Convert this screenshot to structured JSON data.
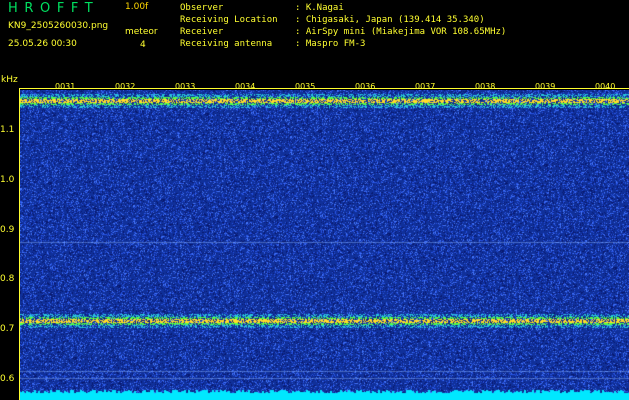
{
  "header": {
    "app_title": "HROFFT",
    "version": "1.00f",
    "file_name": "KN9_2505260030.png",
    "mode_label": "meteor",
    "timestamp": "25.05.26 00:30",
    "mode_count": "4"
  },
  "info": {
    "rows": [
      {
        "label": "Observer",
        "value": ": K.Nagai"
      },
      {
        "label": "Receiving Location",
        "value": ": Chigasaki, Japan (139.414 35.340)"
      },
      {
        "label": "Receiver",
        "value": ": AirSpy mini (Miakejima VOR 108.65MHz)"
      },
      {
        "label": "Receiving antenna",
        "value": ": Maspro FM-3"
      }
    ]
  },
  "axis": {
    "y_unit": "kHz",
    "y_ticks": [
      "1.1",
      "1.0",
      "0.9",
      "0.8",
      "0.7",
      "0.6"
    ],
    "x_ticks": [
      "0031",
      "0032",
      "0033",
      "0034",
      "0035",
      "0036",
      "0037",
      "0038",
      "0039",
      "0040"
    ]
  },
  "spectrogram": {
    "bands_khz": [
      1.16,
      0.72
    ],
    "colors": {
      "background": "#10309a",
      "noise": "#2a5cff",
      "band": "#40ff40",
      "band_core": "#ffe020",
      "floor": "#00e8ff",
      "text": "#ffff30",
      "title": "#00e060"
    }
  }
}
